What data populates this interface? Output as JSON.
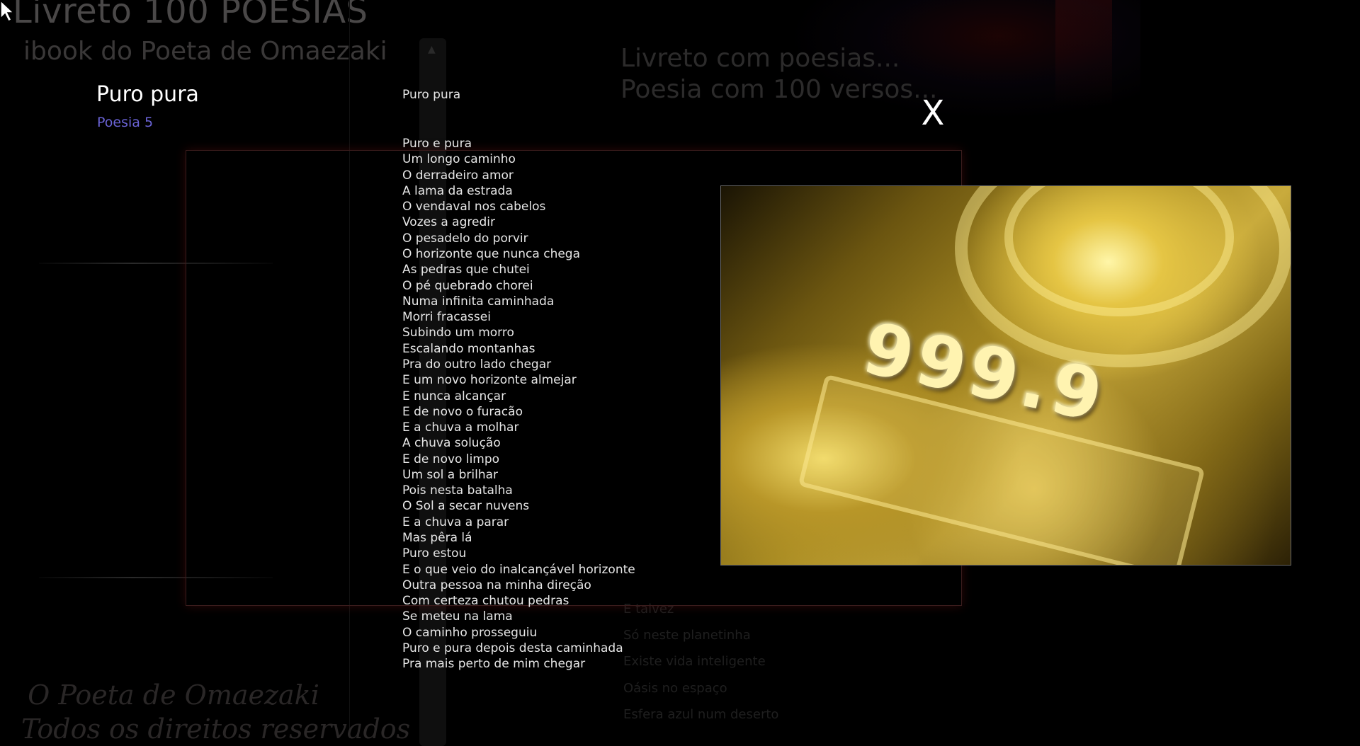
{
  "app": {
    "title": "Livreto 100 POESIAS",
    "subtitle": "ibook do Poeta de Omaezaki"
  },
  "background": {
    "tagline": [
      "Livreto com poesias...",
      "Poesia com 100 versos..."
    ],
    "poem_lines": [
      "E talvez",
      "Só neste planetinha",
      "Existe vida inteligente",
      "Oásis no espaço",
      "Esfera azul num deserto"
    ],
    "footer": [
      "O Poeta de Omaezaki",
      "Todos os direitos reservados"
    ]
  },
  "viewer": {
    "name": "Puro pura",
    "number_label": "Poesia 5",
    "heading": "Puro pura",
    "close_label": "X",
    "lines": [
      "Puro e pura",
      "Um longo caminho",
      "O derradeiro amor",
      "A lama da estrada",
      "O vendaval nos cabelos",
      "Vozes a agredir",
      "O pesadelo do porvir",
      "O horizonte que nunca chega",
      "As pedras que chutei",
      "O pé quebrado chorei",
      "Numa infinita caminhada",
      "Morri fracassei",
      "Subindo um morro",
      "Escalando montanhas",
      "Pra do outro lado chegar",
      "E um novo horizonte almejar",
      "E nunca alcançar",
      "E de novo o furacão",
      "E a chuva a molhar",
      "A chuva solução",
      "E de novo limpo",
      "Um sol a brilhar",
      "Pois nesta batalha",
      "O Sol a secar nuvens",
      "E a chuva a parar",
      "Mas pêra lá",
      "Puro estou",
      "E o que veio do inalcançável horizonte",
      "Outra pessoa na minha direção",
      "Com certeza chutou pedras",
      "Se meteu na lama",
      "O caminho prosseguiu",
      "Puro e pura depois desta caminhada",
      "Pra mais perto de mim chegar"
    ],
    "photo": {
      "marking": "999.9",
      "icon": "gold-bar-photo"
    }
  },
  "colors": {
    "background": "#000000",
    "poem_text": "#e6e6e6",
    "poem_number": "#6a63d6",
    "frame_glow": "#3a1c1c"
  }
}
